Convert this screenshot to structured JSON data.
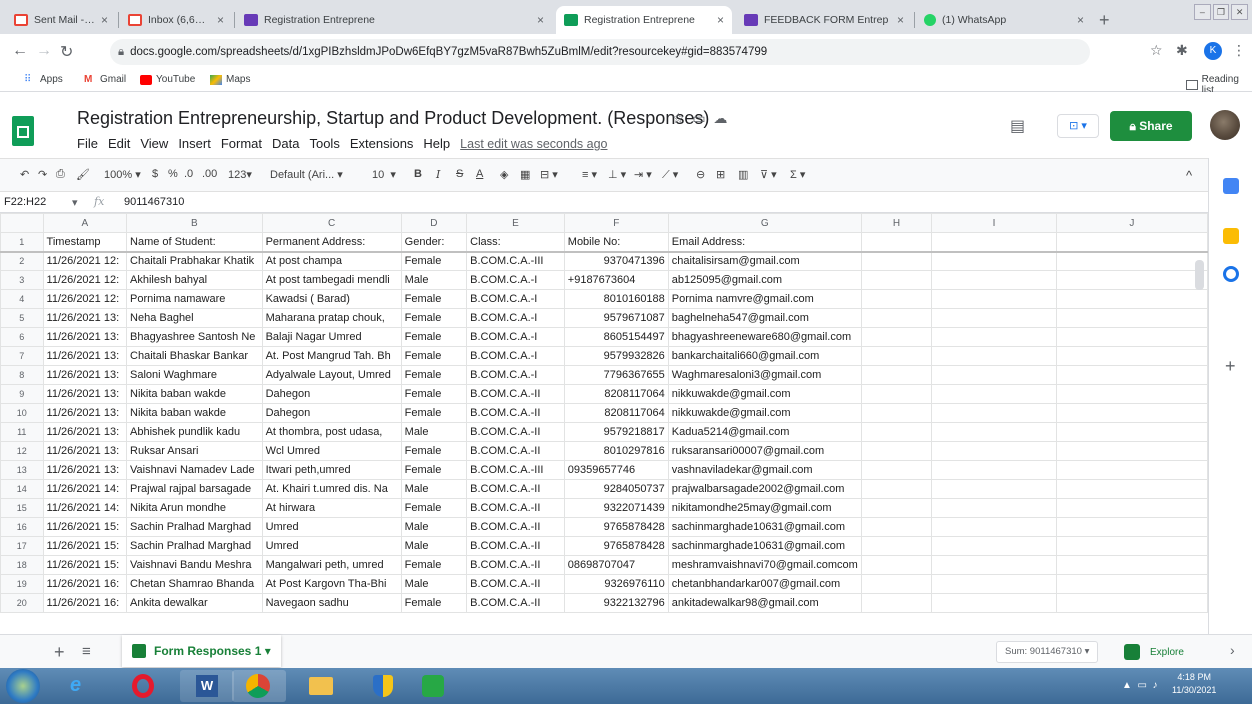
{
  "browser": {
    "tabs": [
      {
        "label": "Sent Mail - khushbooghe",
        "favicon": "gmail-icon",
        "active": false
      },
      {
        "label": "Inbox (6,624) - rbcollege",
        "favicon": "gmail-icon",
        "active": false
      },
      {
        "label": "Registration Entreprene",
        "favicon": "forms-icon",
        "active": false
      },
      {
        "label": "Registration Entreprene",
        "favicon": "sheets-icon",
        "active": true
      },
      {
        "label": "FEEDBACK FORM Entrep",
        "favicon": "forms-icon",
        "active": false
      },
      {
        "label": "(1) WhatsApp",
        "favicon": "whatsapp-icon",
        "active": false
      }
    ],
    "url": "docs.google.com/spreadsheets/d/1xgPIBzhsldmJPoDw6EfqBY7gzM5vaR87Bwh5ZuBmlM/edit?resourcekey#gid=883574799",
    "profile_initial": "K",
    "bookmarks": [
      {
        "label": "Apps",
        "icon": "apps-grid-icon"
      },
      {
        "label": "Gmail",
        "icon": "gmail-icon"
      },
      {
        "label": "YouTube",
        "icon": "youtube-icon"
      },
      {
        "label": "Maps",
        "icon": "maps-icon"
      }
    ],
    "reading_list": "Reading list"
  },
  "sheets": {
    "title": "Registration Entrepreneurship, Startup and Product Development. (Responses)",
    "menu": [
      "File",
      "Edit",
      "View",
      "Insert",
      "Format",
      "Data",
      "Tools",
      "Extensions",
      "Help"
    ],
    "last_edit": "Last edit was seconds ago",
    "share_label": "Share",
    "toolbar": {
      "zoom": "100%",
      "currency": "$",
      "percent": "%",
      "dec_less": ".0",
      "dec_more": ".00",
      "more_formats": "123",
      "font": "Default (Ari...",
      "font_size": "10"
    },
    "name_box": "F22:H22",
    "formula_value": "9011467310"
  },
  "grid": {
    "columns": [
      "A",
      "B",
      "C",
      "D",
      "E",
      "F",
      "G",
      "H",
      "I",
      "J"
    ],
    "header_row": [
      "Timestamp",
      "Name of Student:",
      "Permanent Address:",
      "Gender:",
      "Class:",
      "Mobile No:",
      "Email Address:",
      "",
      "",
      ""
    ],
    "rows": [
      [
        "11/26/2021 12:",
        "Chaitali Prabhakar Khatik",
        "At post champa",
        "Female",
        "B.COM.C.A.-III",
        "9370471396",
        "chaitalisirsam@gmail.com"
      ],
      [
        "11/26/2021 12:",
        "Akhilesh bahyal",
        "At post tambegadi mendli",
        "Male",
        "B.COM.C.A.-I",
        "+9187673604",
        "ab125095@gmail.com"
      ],
      [
        "11/26/2021 12:",
        "Pornima namaware",
        "Kawadsi ( Barad)",
        "Female",
        "B.COM.C.A.-I",
        "8010160188",
        "Pornima namvre@gmail.com"
      ],
      [
        "11/26/2021 13:",
        "Neha Baghel",
        "Maharana pratap chouk,",
        "Female",
        "B.COM.C.A.-I",
        "9579671087",
        "baghelneha547@gmail.com"
      ],
      [
        "11/26/2021 13:",
        "Bhagyashree Santosh Ne",
        "Balaji Nagar Umred",
        "Female",
        "B.COM.C.A.-I",
        "8605154497",
        "bhagyashreeneware680@gmail.com"
      ],
      [
        "11/26/2021 13:",
        "Chaitali Bhaskar Bankar",
        "At. Post Mangrud Tah. Bh",
        "Female",
        "B.COM.C.A.-I",
        "9579932826",
        "bankarchaitali660@gmail.com"
      ],
      [
        "11/26/2021 13:",
        "Saloni Waghmare",
        "Adyalwale Layout, Umred",
        "Female",
        "B.COM.C.A.-I",
        "7796367655",
        "Waghmaresaloni3@gmail.com"
      ],
      [
        "11/26/2021 13:",
        "Nikita baban wakde",
        "Dahegon",
        "Female",
        "B.COM.C.A.-II",
        "8208117064",
        "nikkuwakde@gmail.com"
      ],
      [
        "11/26/2021 13:",
        "Nikita baban wakde",
        "Dahegon",
        "Female",
        "B.COM.C.A.-II",
        "8208117064",
        "nikkuwakde@gmail.com"
      ],
      [
        "11/26/2021 13:",
        "Abhishek pundlik kadu",
        "At thombra, post udasa,",
        "Male",
        "B.COM.C.A.-II",
        "9579218817",
        "Kadua5214@gmail.com"
      ],
      [
        "11/26/2021 13:",
        "Ruksar Ansari",
        "Wcl Umred",
        "Female",
        "B.COM.C.A.-II",
        "8010297816",
        "ruksaransari00007@gmail.com"
      ],
      [
        "11/26/2021 13:",
        "Vaishnavi Namadev Lade",
        "Itwari peth,umred",
        "Female",
        "B.COM.C.A.-III",
        "09359657746",
        "vashnaviladekar@gmail.com"
      ],
      [
        "11/26/2021 14:",
        "Prajwal rajpal barsagade",
        "At. Khairi t.umred dis. Na",
        "Male",
        "B.COM.C.A.-II",
        "9284050737",
        "prajwalbarsagade2002@gmail.com"
      ],
      [
        "11/26/2021 14:",
        "Nikita Arun mondhe",
        "At hirwara",
        "Female",
        "B.COM.C.A.-II",
        "9322071439",
        "nikitamondhe25may@gmail.com"
      ],
      [
        "11/26/2021 15:",
        "Sachin Pralhad Marghad",
        "Umred",
        "Male",
        "B.COM.C.A.-II",
        "9765878428",
        "sachinmarghade10631@gmail.com"
      ],
      [
        "11/26/2021 15:",
        "Sachin Pralhad Marghad",
        "Umred",
        "Male",
        "B.COM.C.A.-II",
        "9765878428",
        "sachinmarghade10631@gmail.com"
      ],
      [
        "11/26/2021 15:",
        "Vaishnavi Bandu Meshra",
        "Mangalwari peth, umred",
        "Female",
        "B.COM.C.A.-II",
        "08698707047",
        "meshramvaishnavi70@gmail.comcom"
      ],
      [
        "11/26/2021 16:",
        "Chetan Shamrao Bhanda",
        "At Post Kargovn Tha-Bhi",
        "Male",
        "B.COM.C.A.-II",
        "9326976110",
        "chetanbhandarkar007@gmail.com"
      ],
      [
        "11/26/2021 16:",
        "Ankita dewalkar",
        "Navegaon sadhu",
        "Female",
        "B.COM.C.A.-II",
        "9322132796",
        "ankitadewalkar98@gmail.com"
      ]
    ]
  },
  "footer": {
    "sheet_tab": "Form Responses 1",
    "sum": "Sum: 9011467310",
    "explore": "Explore"
  },
  "taskbar": {
    "time": "4:18 PM",
    "date": "11/30/2021"
  },
  "colors": {
    "sheets_green": "#0f9d58",
    "share_green": "#1e8e3e",
    "chrome_tabstrip": "#dee1e6"
  }
}
